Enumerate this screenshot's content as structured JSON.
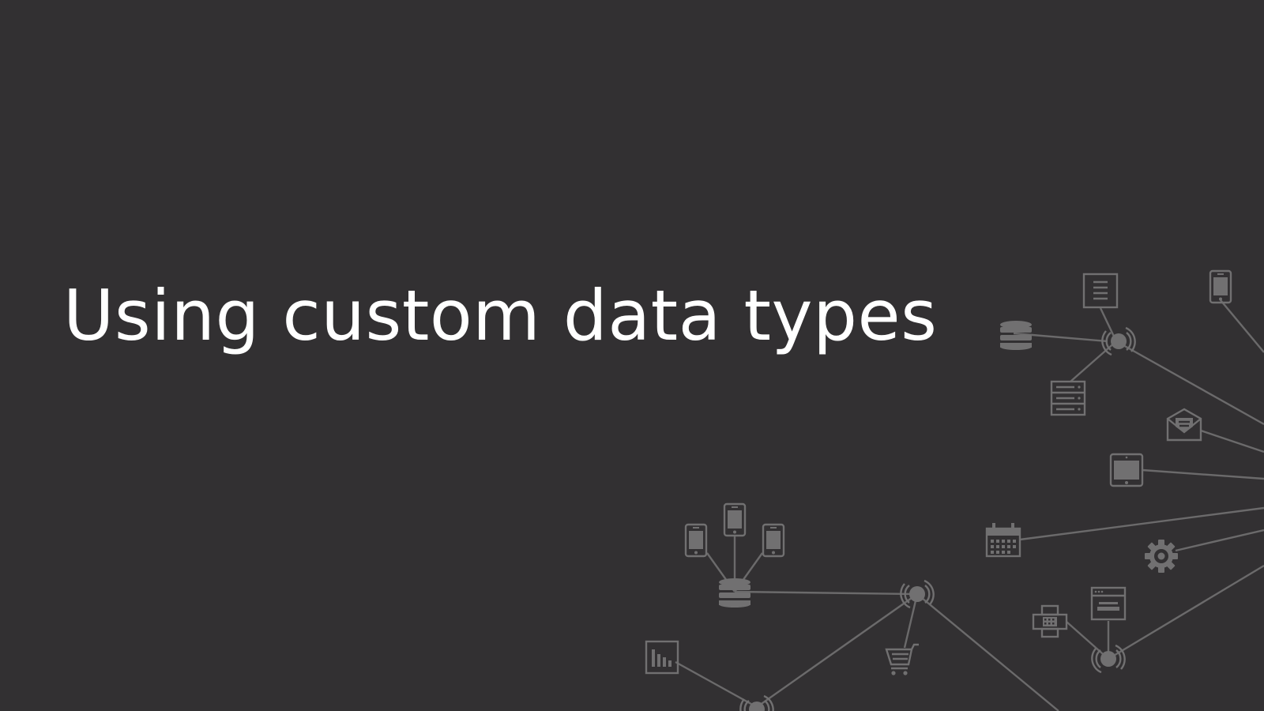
{
  "slide": {
    "title": "Using custom data types",
    "background_color": "#323032",
    "title_color": "#ffffff",
    "graphic_color": "#717071"
  },
  "network_icons": [
    "document-icon",
    "phone-icon",
    "database-icon",
    "hub-node-icon",
    "server-icon",
    "mail-icon",
    "tablet-icon",
    "calendar-icon",
    "gear-icon",
    "phone-icon",
    "database-icon",
    "hub-node-icon",
    "cart-icon",
    "bar-chart-icon",
    "browser-window-icon",
    "fax-icon"
  ]
}
